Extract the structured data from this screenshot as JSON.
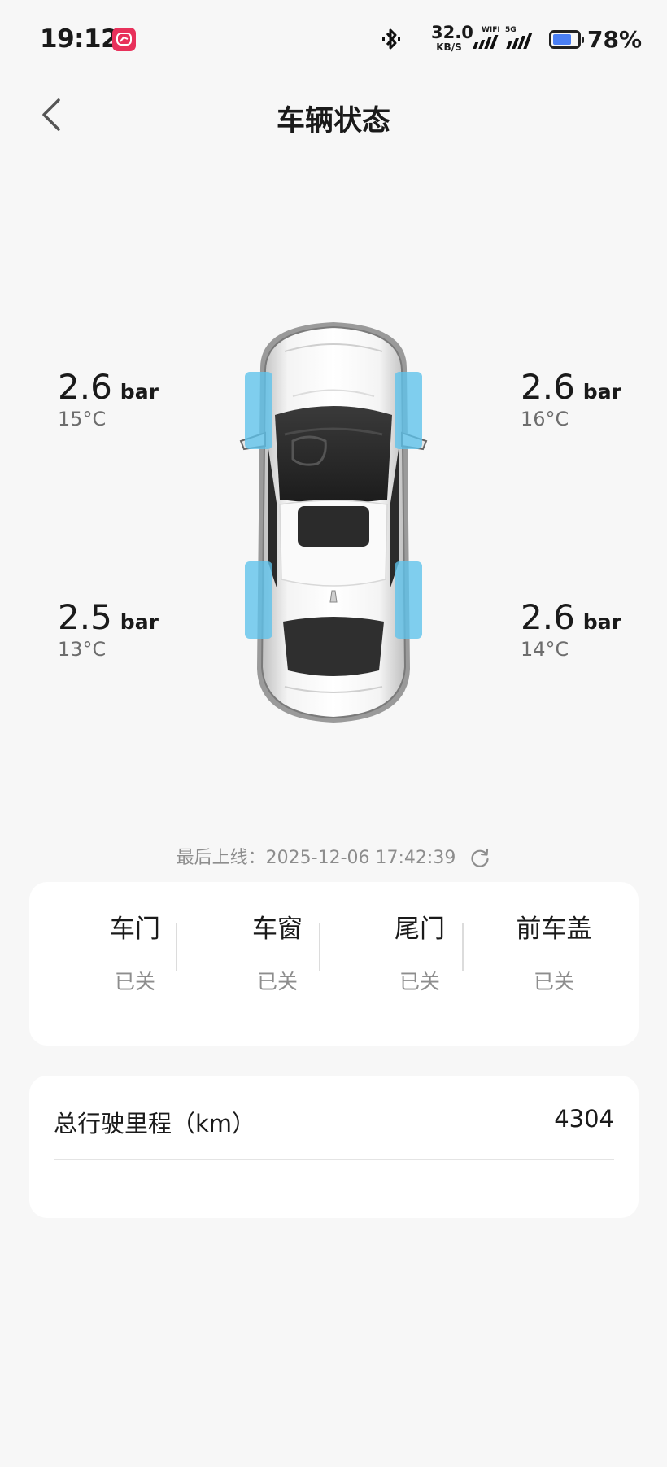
{
  "status_bar": {
    "time": "19:12",
    "net_speed_value": "32.0",
    "net_speed_unit": "KB/S",
    "wifi_label": "WIFI",
    "cell_label": "5G",
    "battery_percent": "78%",
    "battery_level": 0.78,
    "icons": [
      "app-badge-icon",
      "bluetooth-icon",
      "wifi-signal-icon",
      "cell-signal-icon",
      "battery-icon"
    ]
  },
  "header": {
    "title": "车辆状态",
    "back_icon": "chevron-left-icon"
  },
  "tires": {
    "front_left": {
      "pressure": "2.6",
      "unit": "bar",
      "temp": "15°C"
    },
    "front_right": {
      "pressure": "2.6",
      "unit": "bar",
      "temp": "16°C"
    },
    "rear_left": {
      "pressure": "2.5",
      "unit": "bar",
      "temp": "13°C"
    },
    "rear_right": {
      "pressure": "2.6",
      "unit": "bar",
      "temp": "14°C"
    }
  },
  "last_online": {
    "text": "最后上线：2025-12-06 17:42:39",
    "refresh_icon": "refresh-icon"
  },
  "status": {
    "items": [
      {
        "label": "车门",
        "value": "已关"
      },
      {
        "label": "车窗",
        "value": "已关"
      },
      {
        "label": "尾门",
        "value": "已关"
      },
      {
        "label": "前车盖",
        "value": "已关"
      }
    ]
  },
  "mileage": {
    "label": "总行驶里程（km）",
    "value": "4304"
  },
  "colors": {
    "background": "#f7f7f7",
    "card": "#ffffff",
    "tire_highlight": "#5ec3ec",
    "battery_fill": "#4a7ff5",
    "app_badge": "#e8315b",
    "muted_text": "#8d8d8d"
  }
}
